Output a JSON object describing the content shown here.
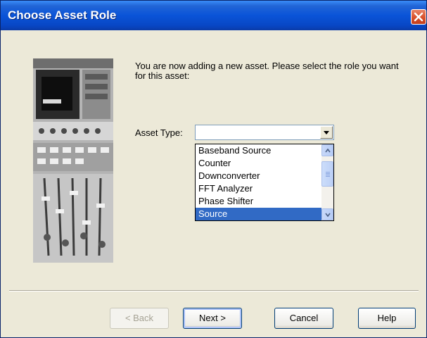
{
  "window": {
    "title": "Choose Asset Role"
  },
  "intro_text": "You are now adding a new asset.  Please select the role you want for this asset:",
  "asset_type": {
    "label": "Asset Type:",
    "value": "",
    "options": [
      "Baseband Source",
      "Counter",
      "Downconverter",
      "FFT Analyzer",
      "Phase Shifter",
      "Source"
    ],
    "selected_index": 5
  },
  "buttons": {
    "back": "< Back",
    "next": "Next >",
    "cancel": "Cancel",
    "help": "Help"
  },
  "colors": {
    "titlebar": "#0A54D8",
    "selection": "#316AC5",
    "dialog_bg": "#ECE9D8"
  }
}
